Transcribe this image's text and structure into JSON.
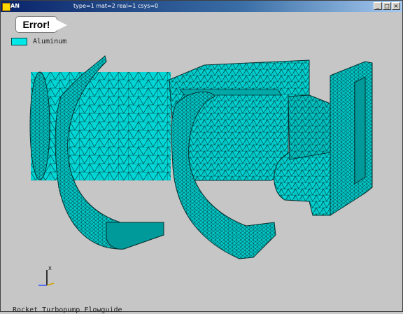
{
  "window": {
    "title_left": "AN",
    "title_right": "type=1 mat=2 real=1 csys=0",
    "controls": [
      "_",
      "□",
      "×"
    ]
  },
  "tooltip": {
    "text": "Error!"
  },
  "legend": {
    "label": "Aluminum",
    "swatch_color": "#00e8e8"
  },
  "triad": {
    "x_label": "X"
  },
  "caption": "Rocket Turbopump Flowguide",
  "colors": {
    "mesh_fill": "#00d6d6",
    "mesh_shadow": "#009a9a",
    "mesh_line": "#06302f",
    "background": "#c6c6c6"
  }
}
